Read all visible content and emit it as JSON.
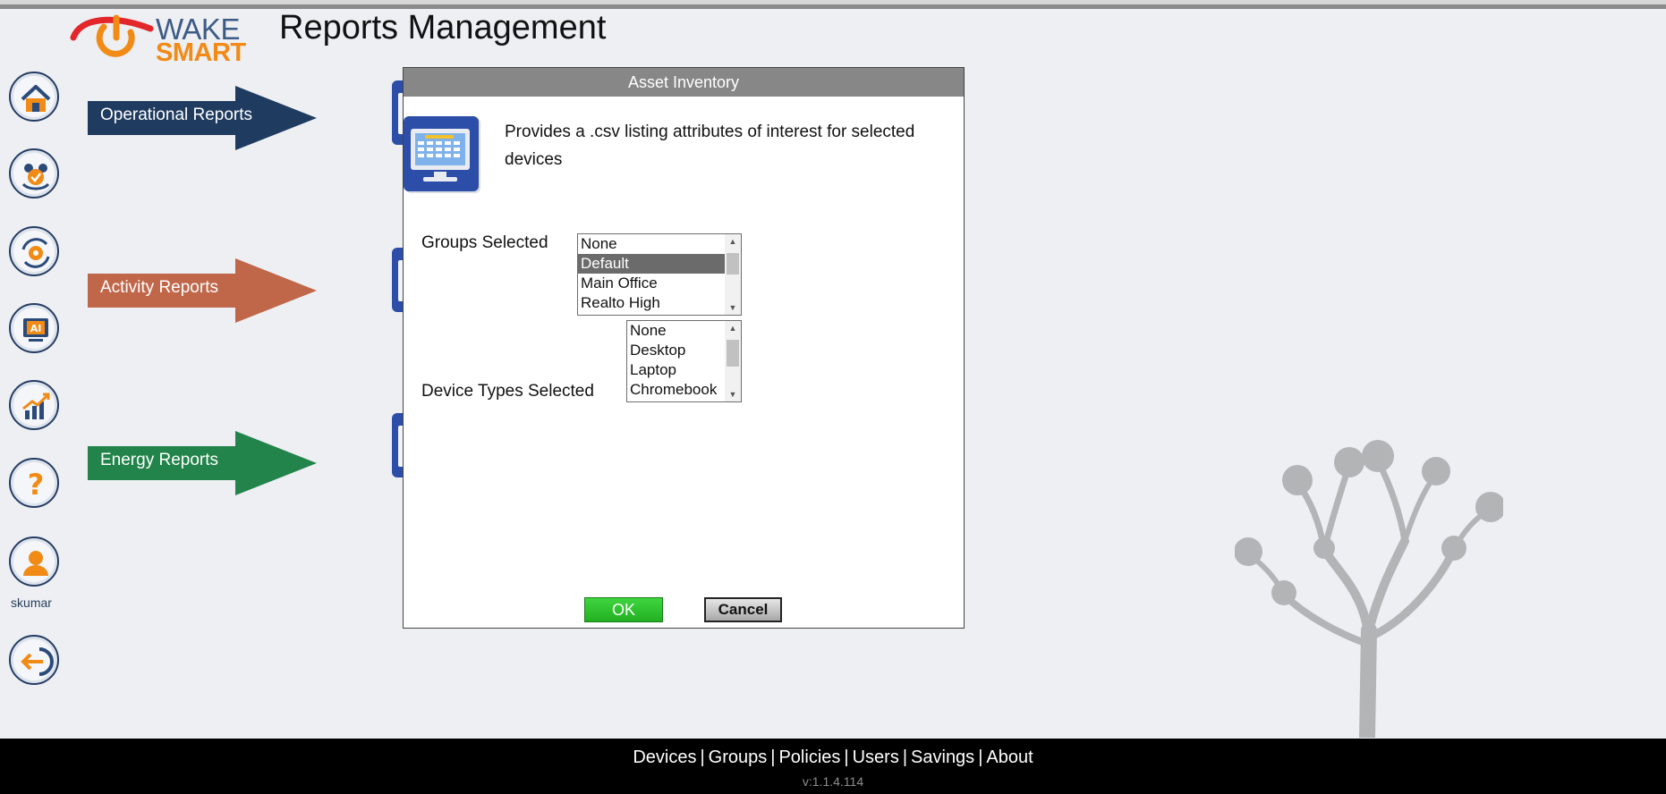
{
  "header": {
    "logo_word_1": "WAKE",
    "logo_word_2": "SMART",
    "title": "Reports Management"
  },
  "sidebar": {
    "items": [
      {
        "name": "home-icon"
      },
      {
        "name": "groups-icon"
      },
      {
        "name": "policies-icon"
      },
      {
        "name": "ai-monitor-icon"
      },
      {
        "name": "savings-chart-icon"
      },
      {
        "name": "help-icon"
      },
      {
        "name": "user-icon"
      },
      {
        "name": "logout-icon"
      }
    ],
    "username": "skumar"
  },
  "report_categories": [
    {
      "label": "Operational Reports",
      "color": "#1f3b5f"
    },
    {
      "label": "Activity Reports",
      "color": "#c0674a"
    },
    {
      "label": "Energy Reports",
      "color": "#22844a"
    }
  ],
  "dialog": {
    "title": "Asset Inventory",
    "description": "Provides a .csv listing attributes of interest for selected devices",
    "groups_label": "Groups Selected",
    "groups_options": [
      "None",
      "Default",
      "Main Office",
      "Realto High"
    ],
    "groups_selected": "Default",
    "device_types_label": "Device Types Selected",
    "device_types_options": [
      "None",
      "Desktop",
      "Laptop",
      "Chromebook"
    ],
    "ok_label": "OK",
    "cancel_label": "Cancel"
  },
  "footer": {
    "links": [
      "Devices",
      "Groups",
      "Policies",
      "Users",
      "Savings",
      "About"
    ],
    "version": "v:1.1.4.114"
  },
  "colors": {
    "background": "#edeff3",
    "dialog_title_bar": "#878787",
    "ok_green": "#2fc42f",
    "footer": "#000000"
  }
}
